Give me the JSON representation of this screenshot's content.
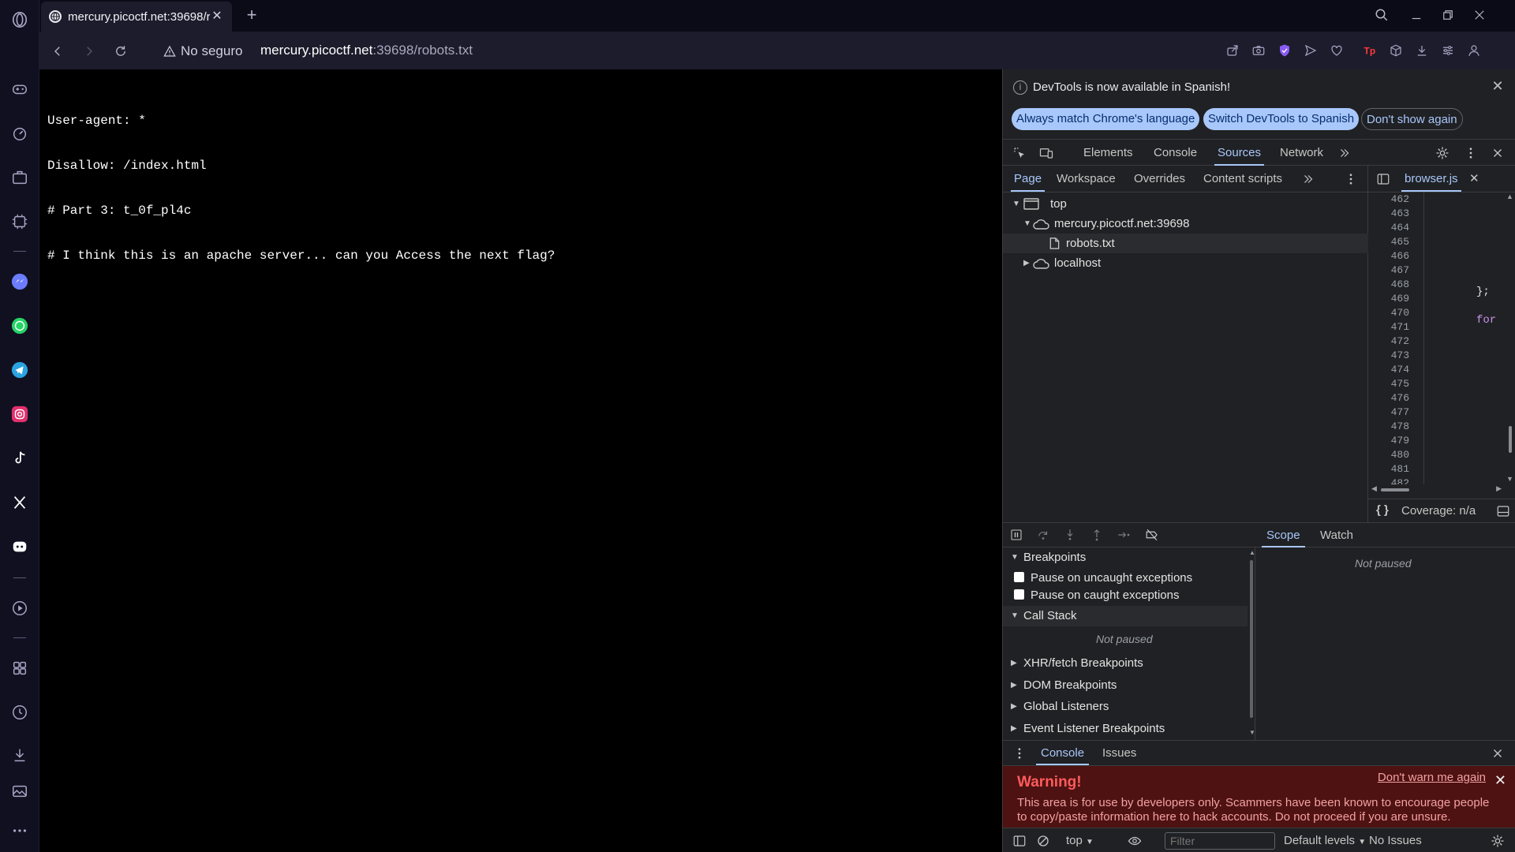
{
  "browser": {
    "tab_title": "mercury.picoctf.net:39698/r",
    "security_label": "No seguro",
    "url_host": "mercury.picoctf.net",
    "url_rest": ":39698/robots.txt"
  },
  "page": {
    "lines": [
      "User-agent: *",
      "Disallow: /index.html",
      "# Part 3: t_0f_pl4c",
      "# I think this is an apache server... can you Access the next flag?"
    ]
  },
  "devtools": {
    "info_message": "DevTools is now available in Spanish!",
    "btn_match": "Always match Chrome's language",
    "btn_switch": "Switch DevTools to Spanish",
    "btn_dont_show": "Don't show again",
    "tabs": [
      "Elements",
      "Console",
      "Sources",
      "Network"
    ],
    "active_tab": "Sources",
    "subtabs": [
      "Page",
      "Workspace",
      "Overrides",
      "Content scripts"
    ],
    "tree": {
      "top": "top",
      "host": "mercury.picoctf.net:39698",
      "file": "robots.txt",
      "localhost": "localhost"
    },
    "editor": {
      "file_tab": "browser.js",
      "line_numbers": [
        "462",
        "463",
        "464",
        "465",
        "466",
        "467",
        "468",
        "469",
        "470",
        "471",
        "472",
        "473",
        "474",
        "475",
        "476",
        "477",
        "478",
        "479",
        "480",
        "481",
        "482"
      ],
      "code_brace": "};",
      "code_keyword": "for",
      "coverage": "Coverage: n/a"
    },
    "debugger": {
      "scope_tab": "Scope",
      "watch_tab": "Watch",
      "not_paused": "Not paused",
      "breakpoints": "Breakpoints",
      "pause_uncaught": "Pause on uncaught exceptions",
      "pause_caught": "Pause on caught exceptions",
      "call_stack": "Call Stack",
      "call_stack_status": "Not paused",
      "xhr": "XHR/fetch Breakpoints",
      "dom": "DOM Breakpoints",
      "global": "Global Listeners",
      "event": "Event Listener Breakpoints"
    },
    "drawer": {
      "console_tab": "Console",
      "issues_tab": "Issues",
      "warning_title": "Warning!",
      "warning_link": "Don't warn me again",
      "warning_body": "This area is for use by developers only. Scammers have been known to encourage people to copy/paste information here to hack accounts. Do not proceed if you are unsure.",
      "context": "top",
      "filter_placeholder": "Filter",
      "levels": "Default levels",
      "issues_count": "No Issues"
    }
  },
  "colors": {
    "accent": "#a8c7fa",
    "warning_bg": "#4e1212",
    "warning_title": "#ff5b5b",
    "code_keyword": "#c792ea"
  }
}
